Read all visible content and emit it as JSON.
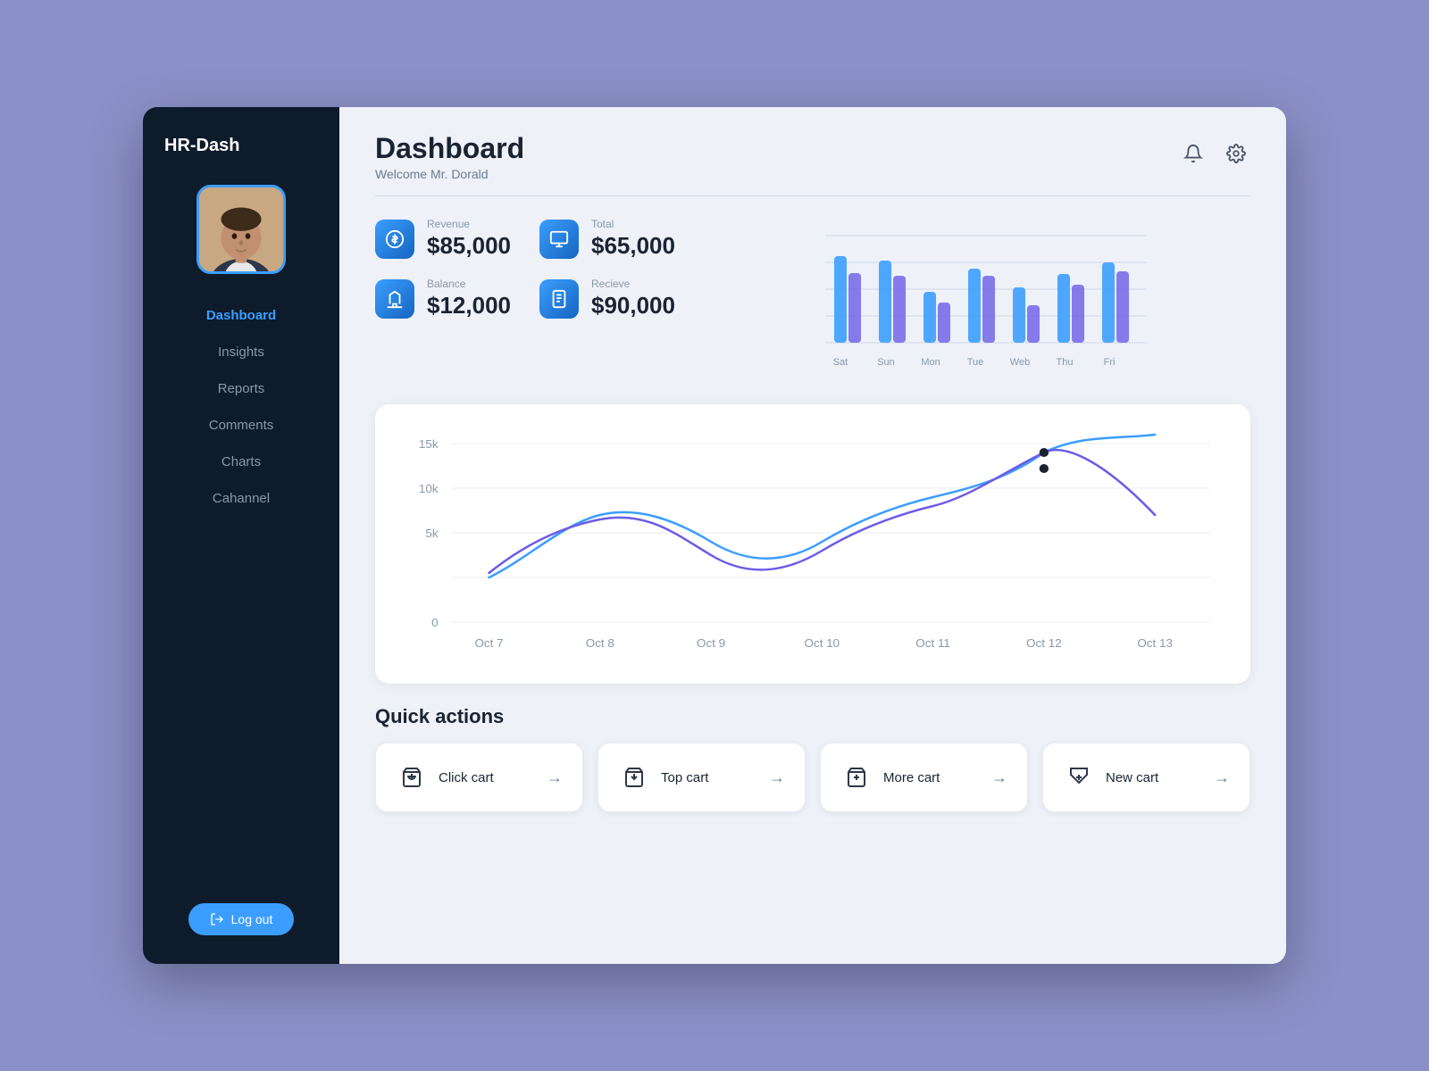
{
  "sidebar": {
    "title": "HR-Dash",
    "nav_items": [
      {
        "label": "Dashboard",
        "active": true
      },
      {
        "label": "Insights",
        "active": false
      },
      {
        "label": "Reports",
        "active": false
      },
      {
        "label": "Comments",
        "active": false
      },
      {
        "label": "Charts",
        "active": false
      },
      {
        "label": "Cahannel",
        "active": false
      }
    ],
    "logout_label": "Log out"
  },
  "header": {
    "title": "Dashboard",
    "welcome": "Welcome Mr. Dorald"
  },
  "stats": [
    {
      "label": "Revenue",
      "value": "$85,000",
      "icon": "revenue"
    },
    {
      "label": "Total",
      "value": "$65,000",
      "icon": "total"
    },
    {
      "label": "Balance",
      "value": "$12,000",
      "icon": "balance"
    },
    {
      "label": "Recieve",
      "value": "$90,000",
      "icon": "receive"
    }
  ],
  "bar_chart": {
    "days": [
      "Sat",
      "Sun",
      "Mon",
      "Tue",
      "Web",
      "Thu",
      "Fri"
    ],
    "series1": [
      72,
      68,
      42,
      58,
      45,
      55,
      65
    ],
    "series2": [
      55,
      52,
      38,
      52,
      32,
      48,
      58
    ]
  },
  "line_chart": {
    "x_labels": [
      "Oct 7",
      "Oct 8",
      "Oct 9",
      "Oct 10",
      "Oct 11",
      "Oct 12",
      "Oct 13"
    ],
    "y_labels": [
      "0",
      "5k",
      "10k",
      "15k"
    ],
    "color1": "#3b9eff",
    "color2": "#6c5ce7"
  },
  "quick_actions": {
    "title": "Quick actions",
    "items": [
      {
        "label": "Click cart",
        "icon": "cart-add"
      },
      {
        "label": "Top cart",
        "icon": "cart-check"
      },
      {
        "label": "More cart",
        "icon": "cart-plus"
      },
      {
        "label": "New cart",
        "icon": "cart-refresh"
      }
    ]
  }
}
